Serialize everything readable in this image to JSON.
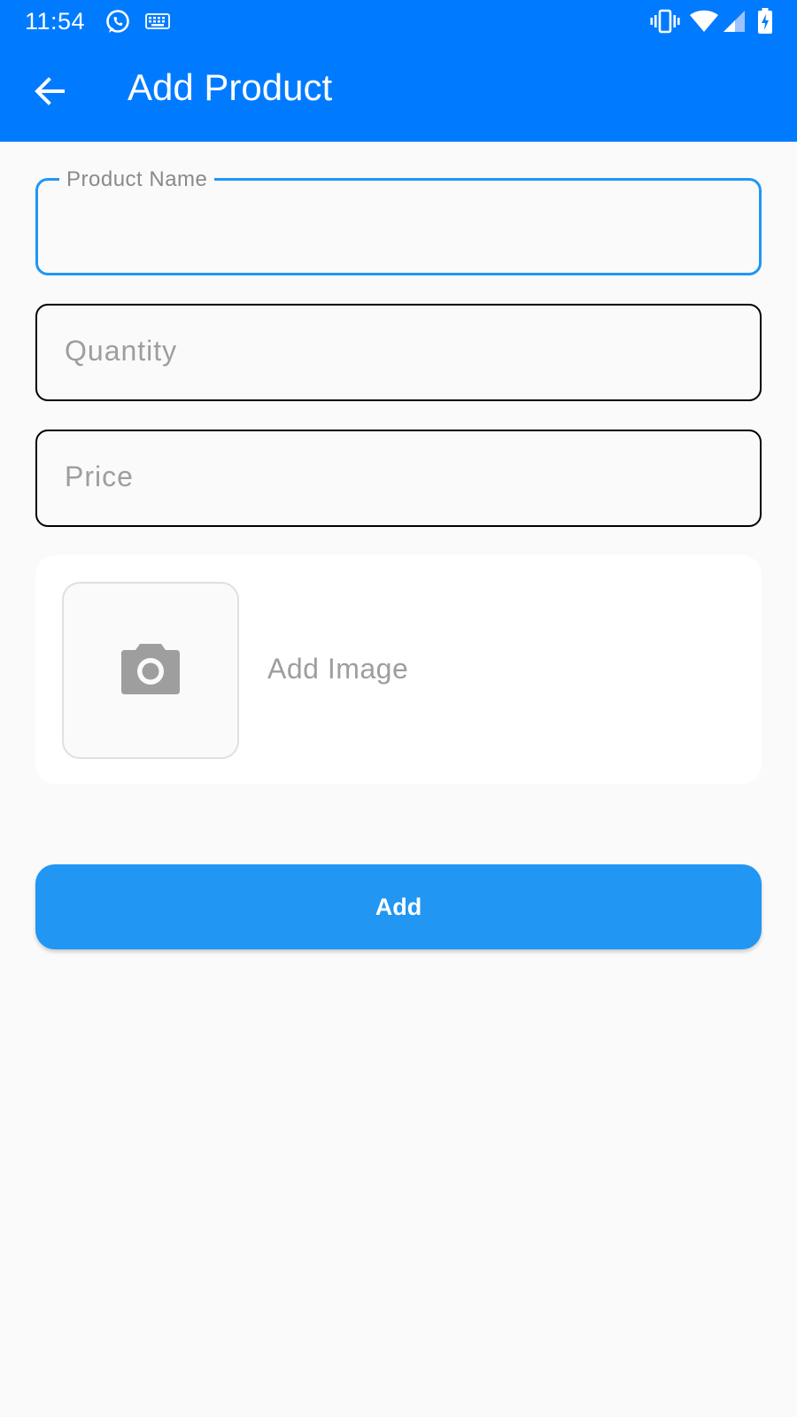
{
  "status_bar": {
    "time": "11:54",
    "left_icons": [
      "whatsapp-icon",
      "keyboard-icon"
    ],
    "right_icons": [
      "vibrate-icon",
      "wifi-icon",
      "cell-signal-icon",
      "battery-charging-icon"
    ]
  },
  "app_bar": {
    "title": "Add Product",
    "back_icon": "arrow-back-icon",
    "color": "#007bff"
  },
  "form": {
    "product_name": {
      "label": "Product Name",
      "value": "",
      "focused": true
    },
    "quantity": {
      "placeholder": "Quantity",
      "value": ""
    },
    "price": {
      "placeholder": "Price",
      "value": ""
    },
    "image": {
      "label": "Add Image",
      "icon": "camera-icon"
    },
    "submit_label": "Add"
  },
  "colors": {
    "primary": "#007bff",
    "button": "#2196f3",
    "focus_border": "#2196f3",
    "hint_text": "#9e9e9e"
  }
}
